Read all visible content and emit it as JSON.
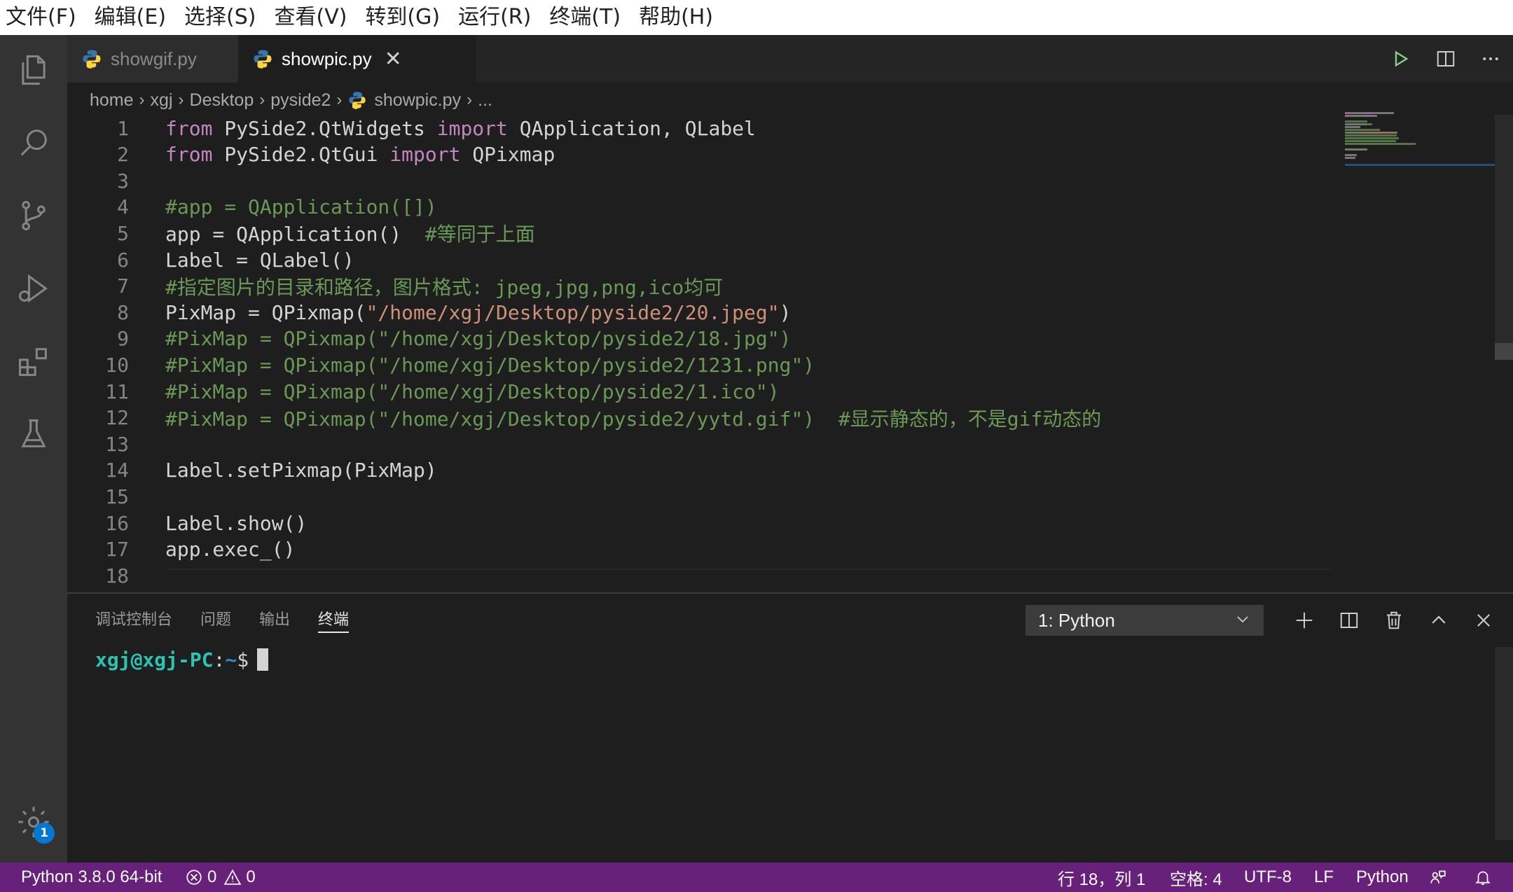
{
  "menu": [
    "文件(F)",
    "编辑(E)",
    "选择(S)",
    "查看(V)",
    "转到(G)",
    "运行(R)",
    "终端(T)",
    "帮助(H)"
  ],
  "activity_bar": {
    "items": [
      "explorer",
      "search",
      "source-control",
      "run-debug",
      "extensions",
      "testing"
    ],
    "settings_badge": "1"
  },
  "tabs": [
    {
      "label": "showgif.py",
      "active": false
    },
    {
      "label": "showpic.py",
      "active": true,
      "close": "✕"
    }
  ],
  "breadcrumb": [
    "home",
    "xgj",
    "Desktop",
    "pyside2",
    "showpic.py",
    "..."
  ],
  "editor": {
    "lines": [
      {
        "n": "1",
        "tokens": [
          {
            "c": "k",
            "t": "from"
          },
          {
            "c": "t",
            "t": " PySide2.QtWidgets "
          },
          {
            "c": "k",
            "t": "import"
          },
          {
            "c": "t",
            "t": " QApplication, QLabel"
          }
        ]
      },
      {
        "n": "2",
        "tokens": [
          {
            "c": "k",
            "t": "from"
          },
          {
            "c": "t",
            "t": " PySide2.QtGui "
          },
          {
            "c": "k",
            "t": "import"
          },
          {
            "c": "t",
            "t": " QPixmap"
          }
        ]
      },
      {
        "n": "3",
        "tokens": []
      },
      {
        "n": "4",
        "tokens": [
          {
            "c": "c",
            "t": "#app = QApplication([])"
          }
        ]
      },
      {
        "n": "5",
        "tokens": [
          {
            "c": "t",
            "t": "app = QApplication()  "
          },
          {
            "c": "c",
            "t": "#等同于上面"
          }
        ]
      },
      {
        "n": "6",
        "tokens": [
          {
            "c": "t",
            "t": "Label = QLabel()"
          }
        ]
      },
      {
        "n": "7",
        "tokens": [
          {
            "c": "c",
            "t": "#指定图片的目录和路径，图片格式: jpeg,jpg,png,ico均可"
          }
        ]
      },
      {
        "n": "8",
        "tokens": [
          {
            "c": "t",
            "t": "PixMap = QPixmap("
          },
          {
            "c": "s",
            "t": "\"/home/xgj/Desktop/pyside2/20.jpeg\""
          },
          {
            "c": "t",
            "t": ")"
          }
        ]
      },
      {
        "n": "9",
        "tokens": [
          {
            "c": "c",
            "t": "#PixMap = QPixmap(\"/home/xgj/Desktop/pyside2/18.jpg\")"
          }
        ]
      },
      {
        "n": "10",
        "tokens": [
          {
            "c": "c",
            "t": "#PixMap = QPixmap(\"/home/xgj/Desktop/pyside2/1231.png\")"
          }
        ]
      },
      {
        "n": "11",
        "tokens": [
          {
            "c": "c",
            "t": "#PixMap = QPixmap(\"/home/xgj/Desktop/pyside2/1.ico\")"
          }
        ]
      },
      {
        "n": "12",
        "tokens": [
          {
            "c": "c",
            "t": "#PixMap = QPixmap(\"/home/xgj/Desktop/pyside2/yytd.gif\")  #显示静态的，不是gif动态的"
          }
        ]
      },
      {
        "n": "13",
        "tokens": []
      },
      {
        "n": "14",
        "tokens": [
          {
            "c": "t",
            "t": "Label.setPixmap(PixMap)"
          }
        ]
      },
      {
        "n": "15",
        "tokens": []
      },
      {
        "n": "16",
        "tokens": [
          {
            "c": "t",
            "t": "Label.show()"
          }
        ]
      },
      {
        "n": "17",
        "tokens": [
          {
            "c": "t",
            "t": "app.exec_()"
          }
        ]
      },
      {
        "n": "18",
        "tokens": []
      }
    ]
  },
  "panel": {
    "tabs": [
      "调试控制台",
      "问题",
      "输出",
      "终端"
    ],
    "active_tab": "终端",
    "terminal_select": "1: Python",
    "prompt": {
      "user": "xgj@xgj-PC",
      "colon": ":",
      "path": "~",
      "dollar": "$"
    }
  },
  "statusbar": {
    "interpreter": "Python 3.8.0 64-bit",
    "errors": "0",
    "warnings": "0",
    "position": "行 18，列 1",
    "indent": "空格: 4",
    "encoding": "UTF-8",
    "eol": "LF",
    "language": "Python"
  },
  "colors": {
    "statusbar": "#68217a",
    "keyword": "#c586c0",
    "comment": "#6a9955",
    "string": "#ce9178",
    "badge": "#0078d4"
  }
}
